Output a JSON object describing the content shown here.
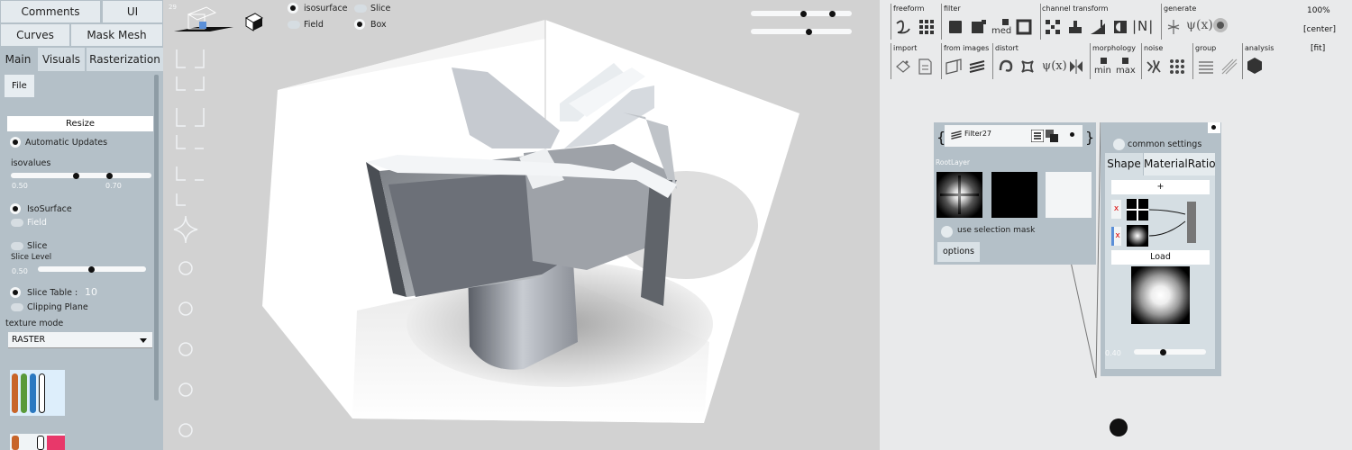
{
  "left_panel": {
    "top_buttons": [
      "Comments",
      "UI",
      "Curves",
      "Mask Mesh"
    ],
    "tabs": [
      "Main",
      "Visuals",
      "Rasterization"
    ],
    "file_label": "File",
    "resize_label": "Resize",
    "automatic_updates": "Automatic Updates",
    "isovalues_label": "isovalues",
    "isovalue_low": "0.50",
    "isovalue_high": "0.70",
    "isosurface_label": "IsoSurface",
    "field_label": "Field",
    "slice_label": "Slice",
    "slice_level_label": "Slice Level",
    "slice_level_value": "0.50",
    "slice_table_label": "Slice Table :",
    "slice_table_value": "10",
    "clipping_plane_label": "Clipping Plane",
    "texture_mode_label": "texture mode",
    "texture_mode_value": "RASTER",
    "swatch_colors": [
      "#c8652a",
      "#5a9a3a",
      "#2a78c0",
      "#ffffff"
    ]
  },
  "viewport": {
    "frame_number": "29",
    "isosurface_label": "isosurface",
    "slice_label": "Slice",
    "field_label": "Field",
    "box_label": "Box"
  },
  "right_panel": {
    "categories": [
      "freeform",
      "filter",
      "channel transform",
      "generate",
      "import",
      "from images",
      "distort",
      "morphology",
      "noise",
      "group",
      "analysis"
    ],
    "zoom": "100%",
    "center": "[center]",
    "fit": "[fit]",
    "med_label": "med",
    "min_label": "min",
    "max_label": "max"
  },
  "filter_node": {
    "title": "Filter27",
    "root_layer": "RootLayer",
    "use_selection_mask": "use selection mask",
    "options": "options"
  },
  "material_node": {
    "common_settings": "common settings",
    "tabs": [
      "Shape",
      "MaterialRatio"
    ],
    "plus": "+",
    "x": "x",
    "load": "Load",
    "value": "0.40"
  }
}
